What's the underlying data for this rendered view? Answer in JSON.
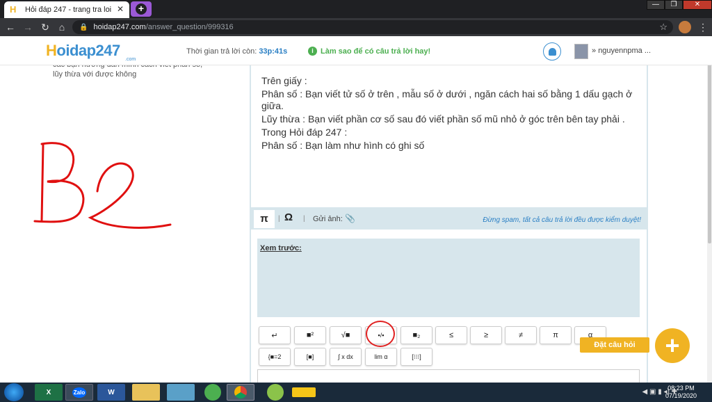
{
  "browser": {
    "tab_title": "Hỏi đáp 247 - trang tra loi",
    "tab_close": "✕",
    "url_host": "hoidap247.com",
    "url_path": "/answer_question/999316"
  },
  "window_controls": {
    "minimize": "—",
    "maximize": "❐",
    "close": "✕"
  },
  "header": {
    "logo": "Hoidap247",
    "logo_sub": ".com",
    "timer_label": "Thời gian trả lời còn:",
    "timer_value": "33p:41s",
    "tip_text": "Làm sao để có câu trả lời hay!",
    "username": "nguyennpma ..."
  },
  "question": {
    "line1": "các bạn hướng dẫn mình cách viết phân số,",
    "line2": "lũy thừa với được không"
  },
  "scribble_text": "B2",
  "answer": {
    "lines": [
      "Trên giấy :",
      "Phân số : Bạn viết tử số ở trên , mẫu số ở dưới , ngăn cách hai số bằng 1 dấu gạch ở giữa.",
      "Lũy thừa : Bạn viết phần cơ số sau đó viết phần số mũ nhỏ ở góc trên bên tay phải .",
      "Trong Hỏi đáp 247 :",
      "Phân số : Bạn làm như hình có ghi số"
    ]
  },
  "toolbar": {
    "pi": "π",
    "omega": "Ω",
    "upload_label": "Gửi ảnh:",
    "no_spam": "Đừng spam, tất cả câu trả lời đều được kiểm duyệt!"
  },
  "preview_label": "Xem trước:",
  "math_buttons_row1": [
    "↵",
    "■²",
    "√■",
    "▪/▪",
    "■₂",
    "≤",
    "≥",
    "≠",
    "π",
    "α"
  ],
  "math_buttons_row2": [
    "{■=2",
    "[■]",
    "∫ x dx",
    "lim α",
    "[⁝⁝⁝]"
  ],
  "ask": {
    "label": "Đặt câu hỏi",
    "plus": "+"
  },
  "taskbar": {
    "zalo": "Zalo",
    "time": "08:23 PM",
    "date": "07/19/2020"
  }
}
